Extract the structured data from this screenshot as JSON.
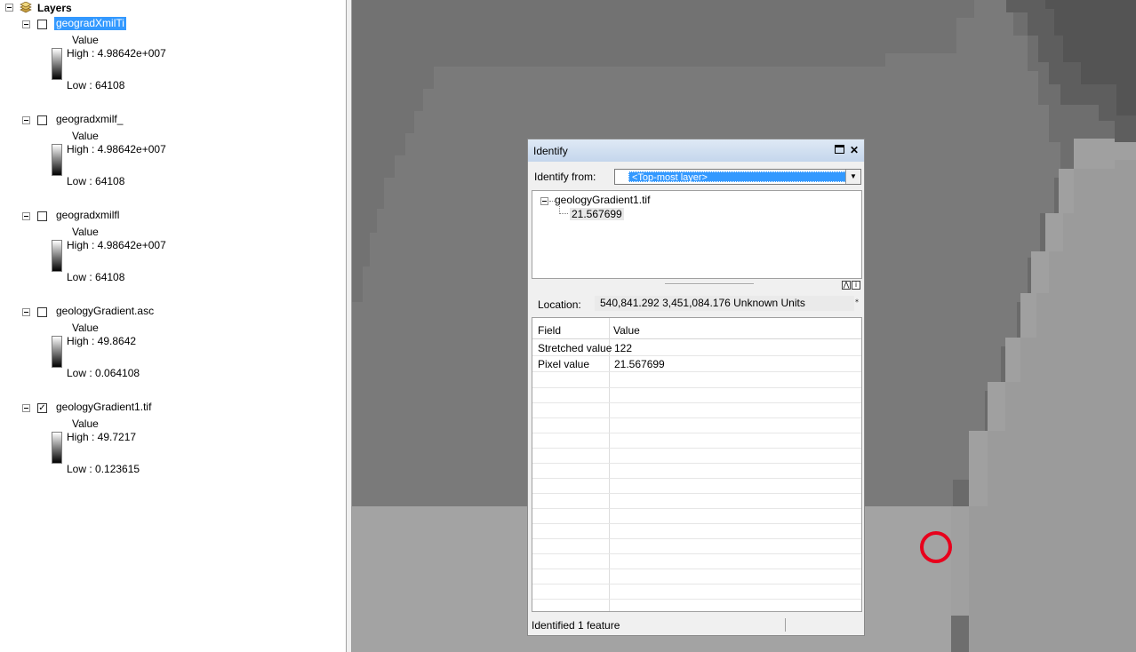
{
  "toc": {
    "root_label": "Layers",
    "layers": [
      {
        "name": "geogradXmilTi",
        "visible": false,
        "selected": true,
        "legend_title": "Value",
        "high": "High : 4.98642e+007",
        "low": "Low : 64108"
      },
      {
        "name": "geogradxmilf_",
        "visible": false,
        "selected": false,
        "legend_title": "Value",
        "high": "High : 4.98642e+007",
        "low": "Low : 64108"
      },
      {
        "name": "geogradxmilfl",
        "visible": false,
        "selected": false,
        "legend_title": "Value",
        "high": "High : 4.98642e+007",
        "low": "Low : 64108"
      },
      {
        "name": "geologyGradient.asc",
        "visible": false,
        "selected": false,
        "legend_title": "Value",
        "high": "High : 49.8642",
        "low": "Low : 0.064108"
      },
      {
        "name": "geologyGradient1.tif",
        "visible": true,
        "selected": false,
        "legend_title": "Value",
        "high": "High : 49.7217",
        "low": "Low : 0.123615"
      }
    ]
  },
  "map": {
    "colors": {
      "darkest": "#545454",
      "dark": "#5e5e5e",
      "mid_dark": "#6e6e6e",
      "mid": "#7a7a7a",
      "light": "#a3a3a3",
      "lighter": "#9b9b9b"
    },
    "marker_color": "#e8001c"
  },
  "identify": {
    "title": "Identify",
    "from_label": "Identify from:",
    "from_value": "<Top-most layer>",
    "tree": {
      "layer": "geologyGradient1.tif",
      "value": "21.567699"
    },
    "location_label": "Location:",
    "location_value": "540,841.292  3,451,084.176 Unknown Units",
    "columns": {
      "field": "Field",
      "value": "Value"
    },
    "rows": [
      {
        "field": "Stretched value",
        "value": "122"
      },
      {
        "field": "Pixel value",
        "value": "21.567699"
      }
    ],
    "status": "Identified 1 feature"
  }
}
